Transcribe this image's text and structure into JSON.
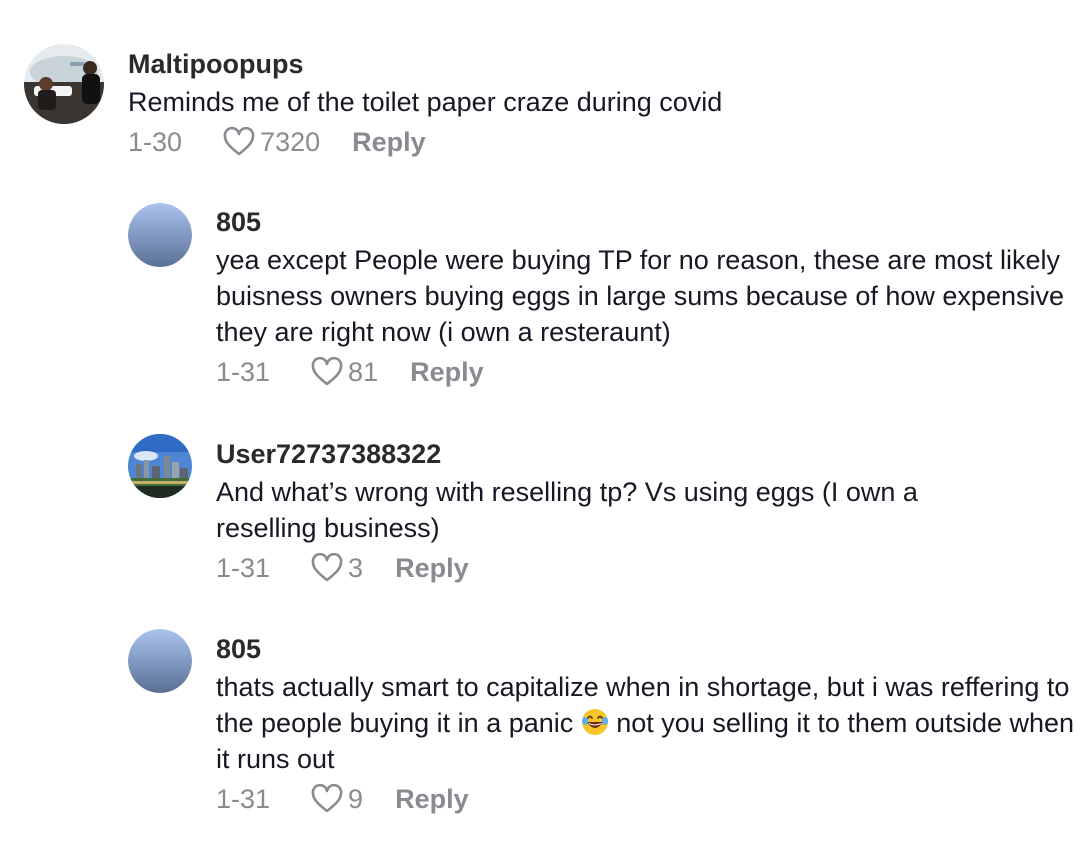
{
  "comments": [
    {
      "username": "Maltipoopups",
      "text": "Reminds me of the toilet paper craze during covid",
      "date": "1-30",
      "likes": "7320",
      "reply_label": "Reply",
      "avatar": "photo-people-plane"
    },
    {
      "username": "805",
      "text": "yea except People were buying TP for no reason, these are most likely buisness owners buying eggs in large sums because of how expensive they are right now (i own a resteraunt)",
      "date": "1-31",
      "likes": "81",
      "reply_label": "Reply",
      "avatar": "gradient-blue"
    },
    {
      "username": "User72737388322",
      "text": "And what’s wrong with reselling tp? Vs using eggs (I own a reselling business)",
      "date": "1-31",
      "likes": "3",
      "reply_label": "Reply",
      "avatar": "photo-city-skyline"
    },
    {
      "username": "805",
      "text_before_emoji": "thats actually smart to capitalize when in shortage, but i was reffering to the people buying it in a panic ",
      "emoji": "laughing-tears-emoji",
      "text_after_emoji": " not you selling it to them outside when it runs out",
      "date": "1-31",
      "likes": "9",
      "reply_label": "Reply",
      "avatar": "gradient-blue"
    }
  ],
  "colors": {
    "username": "#2a2a2a",
    "text": "#161823",
    "meta": "#8a8b91",
    "avatar_gradient_top": "#a9c4ef",
    "avatar_gradient_bottom": "#5a6f95"
  }
}
